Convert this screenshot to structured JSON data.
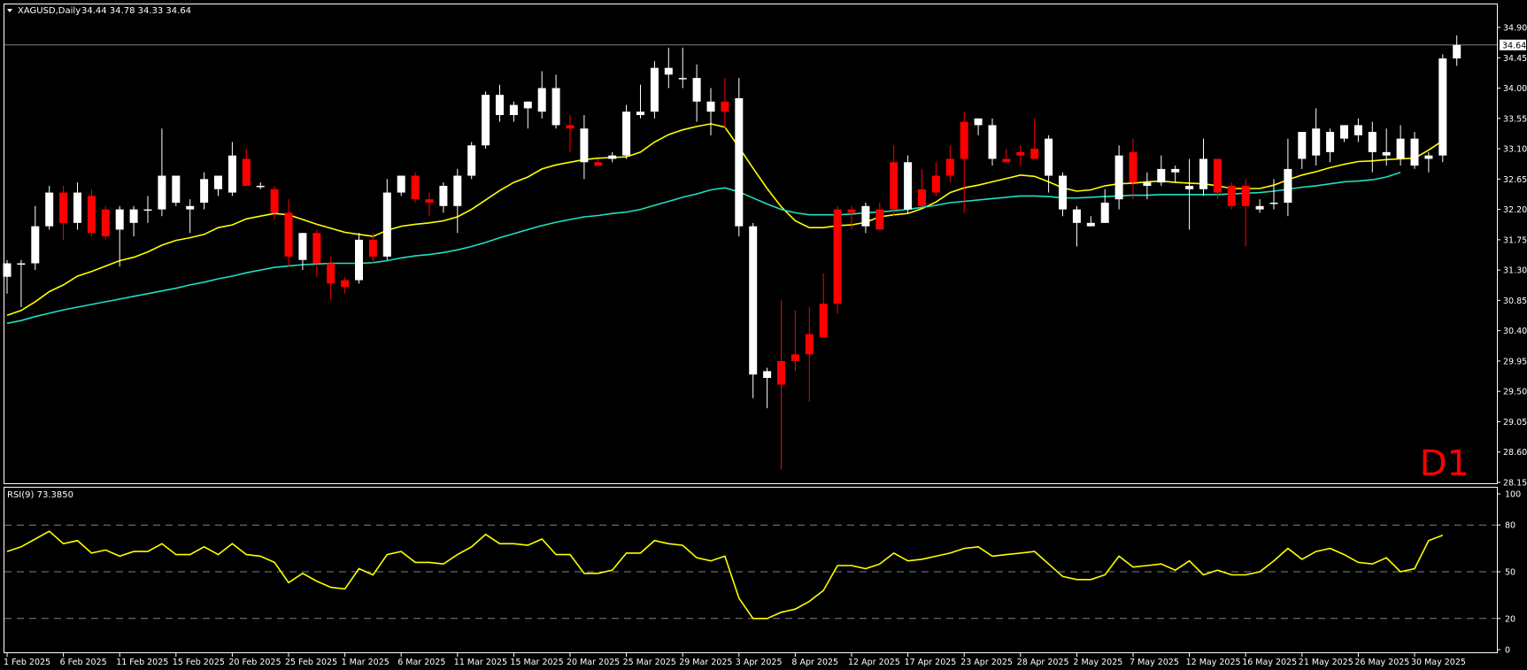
{
  "header": {
    "symbol": "XAGUSD,Daily",
    "ohlc": "34.44 34.78 34.33 34.64"
  },
  "timeframe_label": "D1",
  "current_price_label": "34.64",
  "rsi_label": "RSI(9) 73.3850",
  "colors": {
    "background": "#000000",
    "frame": "#ffffff",
    "bull_candle": "#ffffff",
    "bear_candle": "#ff0000",
    "fast_ma": "#ffff00",
    "slow_ma": "#20e0c0",
    "rsi_line": "#ffff00",
    "rsi_levels": "#808080",
    "price_line": "#808080",
    "timeframe_label": "#ff0000"
  },
  "chart_data": [
    {
      "type": "candlestick",
      "title": "XAGUSD,Daily",
      "ylim": [
        28.15,
        34.9
      ],
      "y_ticks": [
        "34.90",
        "34.45",
        "34.00",
        "33.55",
        "33.10",
        "32.65",
        "32.20",
        "31.75",
        "31.30",
        "30.85",
        "30.40",
        "29.95",
        "29.50",
        "29.05",
        "28.60",
        "28.15"
      ],
      "x_ticks": [
        "1 Feb 2025",
        "6 Feb 2025",
        "11 Feb 2025",
        "15 Feb 2025",
        "20 Feb 2025",
        "25 Feb 2025",
        "1 Mar 2025",
        "6 Mar 2025",
        "11 Mar 2025",
        "15 Mar 2025",
        "20 Mar 2025",
        "25 Mar 2025",
        "29 Mar 2025",
        "3 Apr 2025",
        "8 Apr 2025",
        "12 Apr 2025",
        "17 Apr 2025",
        "23 Apr 2025",
        "28 Apr 2025",
        "2 May 2025",
        "7 May 2025",
        "12 May 2025",
        "16 May 2025",
        "21 May 2025",
        "26 May 2025",
        "30 May 2025"
      ],
      "candles": [
        {
          "o": 31.2,
          "h": 31.45,
          "l": 30.95,
          "c": 31.4
        },
        {
          "o": 31.4,
          "h": 31.45,
          "l": 30.75,
          "c": 31.4
        },
        {
          "o": 31.4,
          "h": 32.25,
          "l": 31.3,
          "c": 31.95
        },
        {
          "o": 31.95,
          "h": 32.55,
          "l": 31.9,
          "c": 32.45
        },
        {
          "o": 32.45,
          "h": 32.55,
          "l": 31.75,
          "c": 32.0
        },
        {
          "o": 32.0,
          "h": 32.6,
          "l": 31.9,
          "c": 32.45
        },
        {
          "o": 32.4,
          "h": 32.5,
          "l": 31.8,
          "c": 31.85
        },
        {
          "o": 32.2,
          "h": 32.25,
          "l": 31.75,
          "c": 31.8
        },
        {
          "o": 31.9,
          "h": 32.25,
          "l": 31.35,
          "c": 32.2
        },
        {
          "o": 32.0,
          "h": 32.25,
          "l": 31.8,
          "c": 32.2
        },
        {
          "o": 32.2,
          "h": 32.4,
          "l": 32.0,
          "c": 32.2
        },
        {
          "o": 32.2,
          "h": 33.4,
          "l": 32.1,
          "c": 32.7
        },
        {
          "o": 32.3,
          "h": 32.7,
          "l": 32.25,
          "c": 32.7
        },
        {
          "o": 32.2,
          "h": 32.35,
          "l": 31.85,
          "c": 32.25
        },
        {
          "o": 32.3,
          "h": 32.75,
          "l": 32.2,
          "c": 32.65
        },
        {
          "o": 32.5,
          "h": 32.7,
          "l": 32.4,
          "c": 32.7
        },
        {
          "o": 32.45,
          "h": 33.2,
          "l": 32.4,
          "c": 33.0
        },
        {
          "o": 32.95,
          "h": 33.1,
          "l": 32.55,
          "c": 32.55
        },
        {
          "o": 32.55,
          "h": 32.6,
          "l": 32.5,
          "c": 32.55
        },
        {
          "o": 32.5,
          "h": 32.55,
          "l": 32.05,
          "c": 32.15
        },
        {
          "o": 32.15,
          "h": 32.35,
          "l": 31.35,
          "c": 31.5
        },
        {
          "o": 31.45,
          "h": 31.85,
          "l": 31.3,
          "c": 31.85
        },
        {
          "o": 31.85,
          "h": 31.9,
          "l": 31.2,
          "c": 31.4
        },
        {
          "o": 31.4,
          "h": 31.5,
          "l": 30.85,
          "c": 31.1
        },
        {
          "o": 31.15,
          "h": 31.2,
          "l": 30.95,
          "c": 31.05
        },
        {
          "o": 31.15,
          "h": 31.85,
          "l": 31.1,
          "c": 31.75
        },
        {
          "o": 31.75,
          "h": 31.85,
          "l": 31.4,
          "c": 31.5
        },
        {
          "o": 31.5,
          "h": 32.65,
          "l": 31.45,
          "c": 32.45
        },
        {
          "o": 32.45,
          "h": 32.7,
          "l": 32.4,
          "c": 32.7
        },
        {
          "o": 32.7,
          "h": 32.75,
          "l": 32.3,
          "c": 32.35
        },
        {
          "o": 32.35,
          "h": 32.45,
          "l": 32.1,
          "c": 32.3
        },
        {
          "o": 32.25,
          "h": 32.6,
          "l": 32.15,
          "c": 32.55
        },
        {
          "o": 32.25,
          "h": 32.8,
          "l": 31.85,
          "c": 32.7
        },
        {
          "o": 32.7,
          "h": 33.2,
          "l": 32.65,
          "c": 33.15
        },
        {
          "o": 33.15,
          "h": 33.95,
          "l": 33.1,
          "c": 33.9
        },
        {
          "o": 33.6,
          "h": 34.05,
          "l": 33.5,
          "c": 33.9
        },
        {
          "o": 33.6,
          "h": 33.8,
          "l": 33.5,
          "c": 33.75
        },
        {
          "o": 33.7,
          "h": 33.8,
          "l": 33.4,
          "c": 33.8
        },
        {
          "o": 33.65,
          "h": 34.25,
          "l": 33.55,
          "c": 34.0
        },
        {
          "o": 33.45,
          "h": 34.2,
          "l": 33.4,
          "c": 34.0
        },
        {
          "o": 33.45,
          "h": 33.6,
          "l": 33.05,
          "c": 33.4
        },
        {
          "o": 32.9,
          "h": 33.6,
          "l": 32.65,
          "c": 33.4
        },
        {
          "o": 32.9,
          "h": 32.95,
          "l": 32.85,
          "c": 32.85
        },
        {
          "o": 32.95,
          "h": 33.05,
          "l": 32.9,
          "c": 33.0
        },
        {
          "o": 33.0,
          "h": 33.75,
          "l": 32.95,
          "c": 33.65
        },
        {
          "o": 33.6,
          "h": 34.05,
          "l": 33.55,
          "c": 33.65
        },
        {
          "o": 33.65,
          "h": 34.4,
          "l": 33.55,
          "c": 34.3
        },
        {
          "o": 34.2,
          "h": 34.6,
          "l": 34.0,
          "c": 34.3
        },
        {
          "o": 34.15,
          "h": 34.6,
          "l": 34.0,
          "c": 34.15
        },
        {
          "o": 33.8,
          "h": 34.35,
          "l": 33.5,
          "c": 34.15
        },
        {
          "o": 33.65,
          "h": 34.0,
          "l": 33.3,
          "c": 33.8
        },
        {
          "o": 33.8,
          "h": 34.15,
          "l": 33.4,
          "c": 33.65
        },
        {
          "o": 31.95,
          "h": 34.15,
          "l": 31.8,
          "c": 33.85
        },
        {
          "o": 29.75,
          "h": 32.0,
          "l": 29.4,
          "c": 31.95
        },
        {
          "o": 29.7,
          "h": 29.85,
          "l": 29.25,
          "c": 29.8
        },
        {
          "o": 29.95,
          "h": 30.85,
          "l": 28.35,
          "c": 29.6
        },
        {
          "o": 30.05,
          "h": 30.7,
          "l": 29.8,
          "c": 29.95
        },
        {
          "o": 30.35,
          "h": 30.75,
          "l": 29.35,
          "c": 30.05
        },
        {
          "o": 30.8,
          "h": 31.25,
          "l": 30.7,
          "c": 30.3
        },
        {
          "o": 32.2,
          "h": 32.25,
          "l": 30.65,
          "c": 30.8
        },
        {
          "o": 32.2,
          "h": 32.25,
          "l": 31.9,
          "c": 32.15
        },
        {
          "o": 31.95,
          "h": 32.3,
          "l": 31.85,
          "c": 32.25
        },
        {
          "o": 32.2,
          "h": 32.3,
          "l": 31.9,
          "c": 31.9
        },
        {
          "o": 32.9,
          "h": 33.15,
          "l": 32.1,
          "c": 32.2
        },
        {
          "o": 32.2,
          "h": 33.0,
          "l": 32.15,
          "c": 32.9
        },
        {
          "o": 32.5,
          "h": 32.8,
          "l": 32.25,
          "c": 32.25
        },
        {
          "o": 32.7,
          "h": 32.9,
          "l": 32.4,
          "c": 32.45
        },
        {
          "o": 32.95,
          "h": 33.15,
          "l": 32.6,
          "c": 32.7
        },
        {
          "o": 33.5,
          "h": 33.65,
          "l": 32.15,
          "c": 32.95
        },
        {
          "o": 33.45,
          "h": 33.55,
          "l": 33.3,
          "c": 33.55
        },
        {
          "o": 32.95,
          "h": 33.55,
          "l": 32.85,
          "c": 33.45
        },
        {
          "o": 32.95,
          "h": 33.1,
          "l": 32.95,
          "c": 32.9
        },
        {
          "o": 33.05,
          "h": 33.15,
          "l": 32.85,
          "c": 33.0
        },
        {
          "o": 33.1,
          "h": 33.55,
          "l": 32.95,
          "c": 32.95
        },
        {
          "o": 32.7,
          "h": 33.3,
          "l": 32.45,
          "c": 33.25
        },
        {
          "o": 32.2,
          "h": 32.75,
          "l": 32.1,
          "c": 32.7
        },
        {
          "o": 32.0,
          "h": 32.25,
          "l": 31.65,
          "c": 32.2
        },
        {
          "o": 31.95,
          "h": 32.1,
          "l": 31.95,
          "c": 32.0
        },
        {
          "o": 32.0,
          "h": 32.5,
          "l": 32.0,
          "c": 32.3
        },
        {
          "o": 32.35,
          "h": 33.15,
          "l": 32.2,
          "c": 33.0
        },
        {
          "o": 33.05,
          "h": 33.25,
          "l": 32.35,
          "c": 32.6
        },
        {
          "o": 32.55,
          "h": 32.75,
          "l": 32.35,
          "c": 32.6
        },
        {
          "o": 32.6,
          "h": 33.0,
          "l": 32.55,
          "c": 32.8
        },
        {
          "o": 32.75,
          "h": 32.85,
          "l": 32.6,
          "c": 32.8
        },
        {
          "o": 32.5,
          "h": 32.95,
          "l": 31.9,
          "c": 32.55
        },
        {
          "o": 32.5,
          "h": 33.25,
          "l": 32.4,
          "c": 32.95
        },
        {
          "o": 32.95,
          "h": 32.95,
          "l": 32.35,
          "c": 32.45
        },
        {
          "o": 32.55,
          "h": 32.6,
          "l": 32.2,
          "c": 32.25
        },
        {
          "o": 32.55,
          "h": 32.65,
          "l": 31.65,
          "c": 32.25
        },
        {
          "o": 32.2,
          "h": 32.35,
          "l": 32.15,
          "c": 32.25
        },
        {
          "o": 32.3,
          "h": 32.65,
          "l": 32.2,
          "c": 32.3
        },
        {
          "o": 32.3,
          "h": 33.25,
          "l": 32.1,
          "c": 32.8
        },
        {
          "o": 32.95,
          "h": 33.35,
          "l": 32.8,
          "c": 33.35
        },
        {
          "o": 33.0,
          "h": 33.7,
          "l": 32.85,
          "c": 33.4
        },
        {
          "o": 33.05,
          "h": 33.4,
          "l": 32.9,
          "c": 33.35
        },
        {
          "o": 33.25,
          "h": 33.45,
          "l": 33.2,
          "c": 33.45
        },
        {
          "o": 33.3,
          "h": 33.55,
          "l": 33.2,
          "c": 33.45
        },
        {
          "o": 33.05,
          "h": 33.5,
          "l": 32.75,
          "c": 33.35
        },
        {
          "o": 33.0,
          "h": 33.4,
          "l": 32.85,
          "c": 33.05
        },
        {
          "o": 32.95,
          "h": 33.45,
          "l": 32.85,
          "c": 33.25
        },
        {
          "o": 32.85,
          "h": 33.35,
          "l": 32.8,
          "c": 33.25
        },
        {
          "o": 32.95,
          "h": 33.05,
          "l": 32.75,
          "c": 33.0
        },
        {
          "o": 33.0,
          "h": 34.5,
          "l": 32.9,
          "c": 34.44
        },
        {
          "o": 34.44,
          "h": 34.78,
          "l": 34.33,
          "c": 34.64
        }
      ],
      "series": [
        {
          "type": "line",
          "color": "#ffff00",
          "values": [
            30.63,
            30.7,
            30.83,
            30.98,
            31.08,
            31.21,
            31.28,
            31.36,
            31.44,
            31.49,
            31.57,
            31.67,
            31.74,
            31.78,
            31.83,
            31.93,
            31.97,
            32.06,
            32.1,
            32.14,
            32.12,
            32.05,
            31.98,
            31.92,
            31.86,
            31.83,
            31.8,
            31.89,
            31.95,
            31.98,
            32.0,
            32.03,
            32.09,
            32.2,
            32.34,
            32.48,
            32.6,
            32.68,
            32.8,
            32.86,
            32.9,
            32.94,
            32.96,
            32.97,
            32.98,
            33.05,
            33.2,
            33.31,
            33.38,
            33.43,
            33.47,
            33.42,
            33.12,
            32.81,
            32.51,
            32.24,
            32.03,
            31.93,
            31.93,
            31.96,
            31.97,
            32.01,
            32.09,
            32.12,
            32.14,
            32.21,
            32.31,
            32.45,
            32.52,
            32.56,
            32.61,
            32.66,
            32.71,
            32.69,
            32.61,
            32.52,
            32.47,
            32.49,
            32.55,
            32.58,
            32.59,
            32.61,
            32.62,
            32.6,
            32.59,
            32.58,
            32.55,
            32.51,
            32.51,
            32.51,
            32.56,
            32.64,
            32.71,
            32.76,
            32.82,
            32.87,
            32.91,
            32.92,
            32.94,
            32.95,
            32.96,
            33.08,
            33.22
          ]
        },
        {
          "type": "line",
          "color": "#20e0c0",
          "values": [
            30.51,
            30.55,
            30.61,
            30.66,
            30.71,
            30.75,
            30.79,
            30.83,
            30.87,
            30.91,
            30.95,
            30.99,
            31.03,
            31.08,
            31.12,
            31.17,
            31.21,
            31.26,
            31.3,
            31.34,
            31.36,
            31.38,
            31.39,
            31.4,
            31.4,
            31.4,
            31.41,
            31.44,
            31.48,
            31.51,
            31.53,
            31.56,
            31.6,
            31.65,
            31.71,
            31.78,
            31.84,
            31.9,
            31.96,
            32.01,
            32.05,
            32.09,
            32.11,
            32.14,
            32.16,
            32.2,
            32.26,
            32.32,
            32.38,
            32.43,
            32.49,
            32.52,
            32.46,
            32.37,
            32.28,
            32.2,
            32.15,
            32.12,
            32.12,
            32.12,
            32.13,
            32.15,
            32.16,
            32.18,
            32.2,
            32.23,
            32.26,
            32.3,
            32.32,
            32.34,
            32.36,
            32.38,
            32.4,
            32.4,
            32.39,
            32.37,
            32.37,
            32.38,
            32.39,
            32.4,
            32.41,
            32.41,
            32.42,
            32.42,
            32.42,
            32.42,
            32.42,
            32.43,
            32.44,
            32.45,
            32.47,
            32.5,
            32.53,
            32.55,
            32.58,
            32.61,
            32.62,
            32.64,
            32.68,
            32.75
          ]
        }
      ]
    },
    {
      "type": "line",
      "title": "RSI(9) 73.3850",
      "ylim": [
        0,
        100
      ],
      "y_ticks": [
        "100",
        "80",
        "50",
        "20",
        "0"
      ],
      "levels": [
        80,
        50,
        20
      ],
      "values": [
        63,
        66,
        71,
        76,
        68,
        70,
        62,
        64,
        60,
        63,
        63,
        68,
        61,
        61,
        66,
        61,
        68,
        61,
        60,
        56,
        43,
        49,
        44,
        40,
        39,
        52,
        48,
        61,
        63,
        56,
        56,
        55,
        61,
        66,
        74,
        68,
        68,
        67,
        71,
        61,
        61,
        49,
        49,
        51,
        62,
        62,
        70,
        68,
        67,
        59,
        57,
        60,
        33,
        20,
        20,
        24,
        26,
        31,
        38,
        54,
        54,
        52,
        55,
        62,
        57,
        58,
        60,
        62,
        65,
        66,
        60,
        61,
        62,
        63,
        55,
        47,
        45,
        45,
        48,
        60,
        53,
        54,
        55,
        51,
        57,
        48,
        51,
        48,
        48,
        50,
        57,
        65,
        58,
        63,
        65,
        61,
        56,
        55,
        59,
        50,
        52,
        70,
        73.385
      ]
    }
  ]
}
